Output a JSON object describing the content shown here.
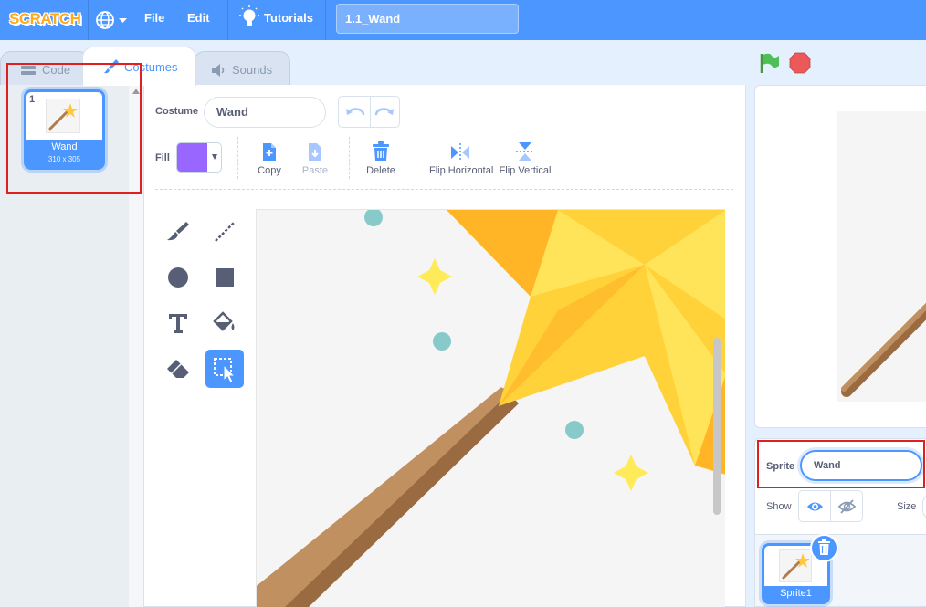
{
  "menubar": {
    "logo_text": "SCRATCH",
    "language_icon": "globe-icon",
    "file_label": "File",
    "edit_label": "Edit",
    "tutorials_label": "Tutorials",
    "project_title": "1.1_Wand"
  },
  "tabs": [
    {
      "label": "Code",
      "icon": "code-icon",
      "active": false
    },
    {
      "label": "Costumes",
      "icon": "brush-icon",
      "active": true
    },
    {
      "label": "Sounds",
      "icon": "speaker-icon",
      "active": false
    }
  ],
  "costume_list": {
    "items": [
      {
        "number": "1",
        "name": "Wand",
        "dimensions": "310 x 305",
        "selected": true
      }
    ]
  },
  "paint_editor": {
    "costume_label": "Costume",
    "costume_name": "Wand",
    "fill_label": "Fill",
    "fill_color": "#9966ff",
    "actions": [
      {
        "label": "Copy",
        "icon": "copy-icon",
        "enabled": true
      },
      {
        "label": "Paste",
        "icon": "paste-icon",
        "enabled": false
      },
      {
        "label": "Delete",
        "icon": "trash-icon",
        "enabled": true
      },
      {
        "label": "Flip Horizontal",
        "icon": "flip-horizontal-icon",
        "enabled": true
      },
      {
        "label": "Flip Vertical",
        "icon": "flip-vertical-icon",
        "enabled": true
      }
    ],
    "tools": [
      {
        "name": "brush",
        "active": false
      },
      {
        "name": "line",
        "active": false
      },
      {
        "name": "circle",
        "active": false
      },
      {
        "name": "rectangle",
        "active": false
      },
      {
        "name": "text",
        "active": false
      },
      {
        "name": "fill",
        "active": false
      },
      {
        "name": "eraser",
        "active": false
      },
      {
        "name": "select",
        "active": true
      }
    ]
  },
  "stage_controls": {
    "green_flag_icon": "green-flag-icon",
    "stop_icon": "stop-icon"
  },
  "sprite_info": {
    "sprite_label": "Sprite",
    "sprite_name": "Wand",
    "show_label": "Show",
    "size_label": "Size"
  },
  "sprites": [
    {
      "name": "Sprite1",
      "selected": true
    }
  ],
  "colors": {
    "menubar": "#4c97ff",
    "accent": "#4c97ff",
    "annotation": "#e0201f",
    "star_light": "#ffe14d",
    "star_dark": "#ffb526",
    "wand_light": "#c09060",
    "wand_dark": "#9a6a40",
    "dot": "#88c9c9"
  }
}
